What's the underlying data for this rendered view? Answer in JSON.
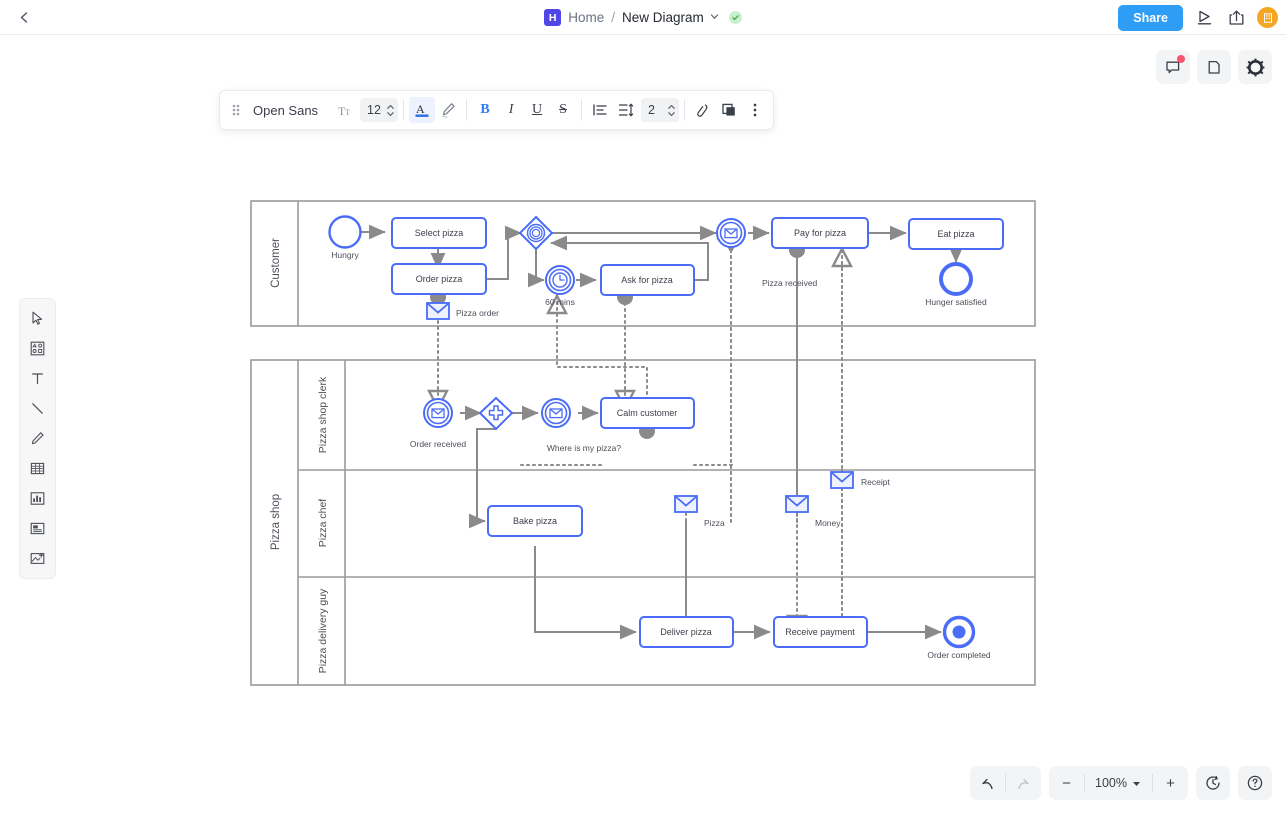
{
  "header": {
    "back_icon": "chevron-left-icon",
    "home_badge": "H",
    "home_label": "Home",
    "separator": "/",
    "doc_title": "New Diagram",
    "caret_icon": "chevron-down-icon",
    "saved_icon": "check-saved-icon",
    "share_label": "Share",
    "present_icon": "present-play-icon",
    "export_icon": "share-export-icon",
    "avatar_icon": "organization-avatar-icon"
  },
  "right_tools": [
    {
      "name": "comments-icon",
      "has_badge": true
    },
    {
      "name": "pages-icon",
      "has_badge": false
    },
    {
      "name": "settings-gear-icon",
      "has_badge": false
    }
  ],
  "format_toolbar": {
    "drag_handle_icon": "drag-dots-icon",
    "font_family": "Open Sans",
    "font_size_icon": "text-size-icon",
    "font_size": "12",
    "text_color_icon": "text-color-A-icon",
    "highlight_icon": "highlighter-icon",
    "bold_label": "B",
    "italic_label": "I",
    "underline_label": "U",
    "strikethrough_label": "S",
    "align_icon": "align-left-icon",
    "line_spacing_icon": "line-spacing-icon",
    "line_spacing_value": "2",
    "link_icon": "link-clip-icon",
    "layers_icon": "duplicate-layers-icon",
    "more_icon": "more-vertical-icon"
  },
  "left_rail": [
    {
      "name": "select-pointer-tool",
      "label": "Select"
    },
    {
      "name": "shapes-library-tool",
      "label": "Shapes"
    },
    {
      "name": "text-tool",
      "label": "Text"
    },
    {
      "name": "line-tool",
      "label": "Line"
    },
    {
      "name": "pen-draw-tool",
      "label": "Draw"
    },
    {
      "name": "table-tool",
      "label": "Table"
    },
    {
      "name": "chart-tool",
      "label": "Chart"
    },
    {
      "name": "note-card-tool",
      "label": "Note"
    },
    {
      "name": "image-insert-tool",
      "label": "Image"
    }
  ],
  "bottom_bar": {
    "undo_icon": "undo-icon",
    "redo_icon": "redo-icon",
    "zoom_out_label": "−",
    "zoom_level": "100%",
    "zoom_caret_icon": "chevron-down-icon",
    "zoom_in_label": "+",
    "history_icon": "version-history-icon",
    "help_icon": "help-question-icon"
  },
  "diagram": {
    "type": "bpmn-pool-lane-diagram",
    "pools": [
      {
        "name": "Customer",
        "lanes": []
      },
      {
        "name": "Pizza shop",
        "lanes": [
          "Pizza shop clerk",
          "Pizza chef",
          "Pizza delivery guy"
        ]
      }
    ],
    "nodes": [
      {
        "id": "hungry",
        "kind": "start-event",
        "label": "Hungry",
        "lane": "Customer"
      },
      {
        "id": "select-pizza",
        "kind": "task",
        "label": "Select pizza",
        "lane": "Customer"
      },
      {
        "id": "order-pizza",
        "kind": "task",
        "label": "Order pizza",
        "lane": "Customer"
      },
      {
        "id": "pizza-order-msg",
        "kind": "message",
        "label": "Pizza order",
        "lane": "Customer"
      },
      {
        "id": "event-gateway",
        "kind": "event-based-gateway",
        "label": "",
        "lane": "Customer"
      },
      {
        "id": "timer-60",
        "kind": "timer-event",
        "label": "60 mins",
        "lane": "Customer"
      },
      {
        "id": "ask-for-pizza",
        "kind": "task",
        "label": "Ask for pizza",
        "lane": "Customer"
      },
      {
        "id": "pizza-received",
        "kind": "message-event",
        "label": "Pizza received",
        "lane": "Customer"
      },
      {
        "id": "pay-for-pizza",
        "kind": "task",
        "label": "Pay for pizza",
        "lane": "Customer"
      },
      {
        "id": "eat-pizza",
        "kind": "task",
        "label": "Eat pizza",
        "lane": "Customer"
      },
      {
        "id": "hunger-satisfied",
        "kind": "end-event",
        "label": "Hunger satisfied",
        "lane": "Customer"
      },
      {
        "id": "order-received",
        "kind": "message-event",
        "label": "Order received",
        "lane": "Pizza shop clerk"
      },
      {
        "id": "parallel-gateway",
        "kind": "parallel-gateway",
        "label": "",
        "lane": "Pizza shop clerk"
      },
      {
        "id": "where-is-my-pizza",
        "kind": "message-event",
        "label": "Where is my pizza?",
        "lane": "Pizza shop clerk"
      },
      {
        "id": "calm-customer",
        "kind": "task",
        "label": "Calm customer",
        "lane": "Pizza shop clerk"
      },
      {
        "id": "receipt-msg",
        "kind": "message",
        "label": "Receipt",
        "lane": "Pizza shop clerk"
      },
      {
        "id": "bake-pizza",
        "kind": "task",
        "label": "Bake pizza",
        "lane": "Pizza chef"
      },
      {
        "id": "pizza-msg",
        "kind": "message",
        "label": "Pizza",
        "lane": "Pizza chef"
      },
      {
        "id": "money-msg",
        "kind": "message",
        "label": "Money",
        "lane": "Pizza chef"
      },
      {
        "id": "deliver-pizza",
        "kind": "task",
        "label": "Deliver pizza",
        "lane": "Pizza delivery guy"
      },
      {
        "id": "receive-payment",
        "kind": "task",
        "label": "Receive payment",
        "lane": "Pizza delivery guy"
      },
      {
        "id": "order-completed",
        "kind": "end-event-filled",
        "label": "Order completed",
        "lane": "Pizza delivery guy"
      }
    ],
    "colors": {
      "node_stroke": "#4a6cf7",
      "node_fill": "#ffffff",
      "flow_line": "#8a8a8a",
      "message_line": "#8a8a8a",
      "lane_border": "#9a9a9a",
      "label_text": "#3b3f4a"
    }
  }
}
